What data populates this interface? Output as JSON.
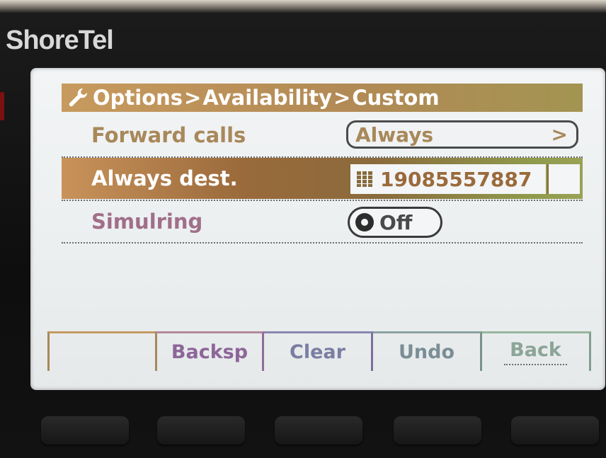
{
  "brand": {
    "logo": "ShoreTel"
  },
  "header": {
    "icon": "wrench-icon",
    "crumbs": [
      "Options",
      "Availability",
      "Custom"
    ],
    "separator": ">"
  },
  "rows": {
    "forward_calls": {
      "label": "Forward calls",
      "value": "Always",
      "chevron": ">"
    },
    "always_dest": {
      "label": "Always dest.",
      "value": "19085557887",
      "icon": "keypad-icon"
    },
    "simulring": {
      "label": "Simulring",
      "value": "Off"
    }
  },
  "softkeys": [
    "",
    "Backsp",
    "Clear",
    "Undo",
    "Back"
  ],
  "colors": {
    "title_bar": "#b28a55",
    "highlight_row": "#9a6a3b",
    "label_gold": "#a8885a",
    "label_mauve": "#a06f8a",
    "screen_bg": "#eef1f2"
  }
}
